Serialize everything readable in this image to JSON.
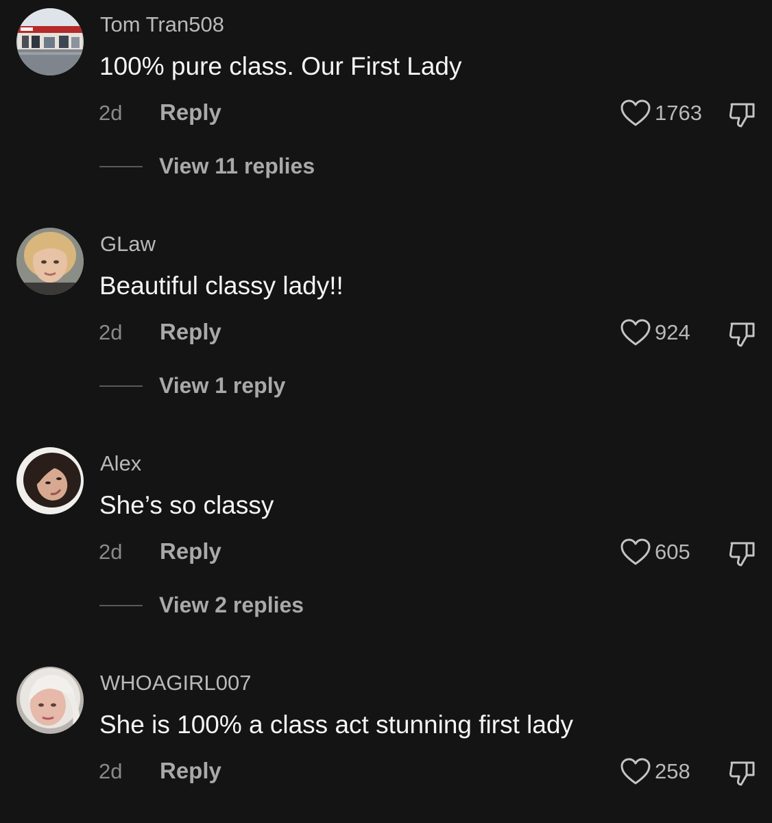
{
  "colors": {
    "background": "#141414",
    "text_primary": "#f5f5f5",
    "text_secondary": "#b9b9b9",
    "text_muted": "#8a8a8a"
  },
  "comments": [
    {
      "username": "Tom Tran508",
      "text": "100% pure class. Our First Lady",
      "time": "2d",
      "reply_label": "Reply",
      "likes": "1763",
      "view_replies": "View 11 replies",
      "avatar": "storefront-photo"
    },
    {
      "username": "GLaw",
      "text": "Beautiful classy lady!!",
      "time": "2d",
      "reply_label": "Reply",
      "likes": "924",
      "view_replies": "View 1 reply",
      "avatar": "blonde-woman-photo"
    },
    {
      "username": "Alex",
      "text": "She’s so classy",
      "time": "2d",
      "reply_label": "Reply",
      "likes": "605",
      "view_replies": "View 2 replies",
      "avatar": "dark-hair-woman-photo"
    },
    {
      "username": "WHOAGIRL007",
      "text": "She is 100% a class act stunning first lady",
      "time": "2d",
      "reply_label": "Reply",
      "likes": "258",
      "avatar": "platinum-hair-woman-photo"
    }
  ]
}
